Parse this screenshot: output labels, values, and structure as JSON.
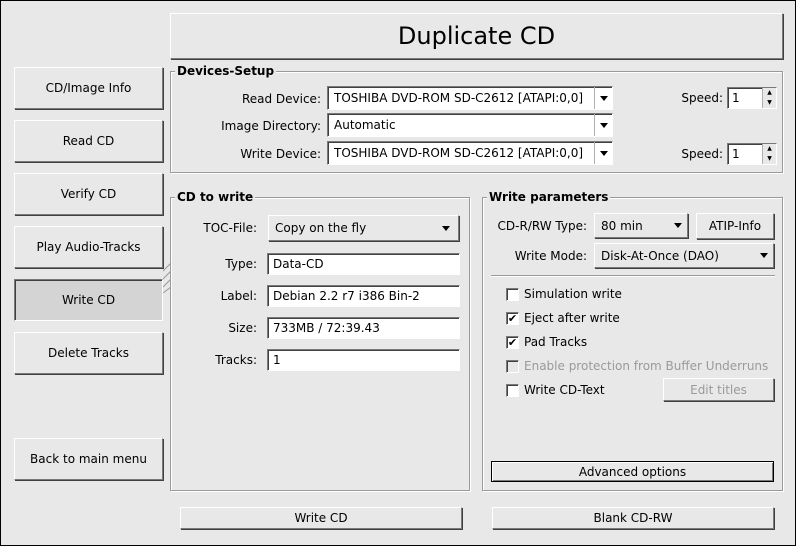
{
  "title": "Duplicate CD",
  "sidebar": {
    "items": [
      {
        "label": "CD/Image Info"
      },
      {
        "label": "Read CD"
      },
      {
        "label": "Verify CD"
      },
      {
        "label": "Play Audio-Tracks"
      },
      {
        "label": "Write CD"
      },
      {
        "label": "Delete Tracks"
      }
    ],
    "back_label": "Back to main menu"
  },
  "devices": {
    "title": "Devices-Setup",
    "read_label": "Read Device:",
    "read_value": "TOSHIBA  DVD-ROM SD-C2612 [ATAPI:0,0]",
    "dir_label": "Image Directory:",
    "dir_value": "Automatic",
    "write_label": "Write Device:",
    "write_value": "TOSHIBA  DVD-ROM SD-C2612 [ATAPI:0,0]",
    "speed_label": "Speed:",
    "read_speed": "1",
    "write_speed": "1"
  },
  "cd_to_write": {
    "title": "CD to write",
    "toc_label": "TOC-File:",
    "toc_value": "Copy on the fly",
    "type_label": "Type:",
    "type_value": "Data-CD",
    "label_label": "Label:",
    "label_value": "Debian 2.2 r7 i386 Bin-2",
    "size_label": "Size:",
    "size_value": "733MB / 72:39.43",
    "tracks_label": "Tracks:",
    "tracks_value": "1"
  },
  "write_params": {
    "title": "Write parameters",
    "cdrw_label": "CD-R/RW Type:",
    "cdrw_value": "80 min",
    "atip_label": "ATIP-Info",
    "mode_label": "Write Mode:",
    "mode_value": "Disk-At-Once (DAO)",
    "sim_label": "Simulation write",
    "eject_label": "Eject after write",
    "pad_label": "Pad Tracks",
    "protect_label": "Enable protection from Buffer Underruns",
    "cdtext_label": "Write CD-Text",
    "edit_titles_label": "Edit titles",
    "advanced_label": "Advanced options",
    "check_mark": "✔"
  },
  "bottom": {
    "write_label": "Write CD",
    "blank_label": "Blank CD-RW"
  }
}
